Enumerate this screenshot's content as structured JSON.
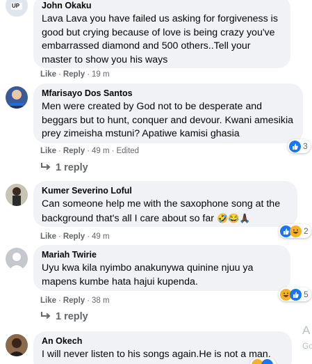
{
  "comments": [
    {
      "author": "John Okaku",
      "text": "Lava Lava you have failed us asking for forgiveness is good but crying because of love is being crazy you've embarrassed diamond and 500 others..Tell your master to show you his ways",
      "like_label": "Like",
      "reply_label": "Reply",
      "time": "19 m",
      "avatar_badge": "UP"
    },
    {
      "author": "Mfarisayo Dos Santos",
      "text": "Men were created by God not to be desperate and beggars but to hunt, conquer and devour. Kwani amesikia prey zimeisha mstuni? Apatiwe kamisi ghasia",
      "like_label": "Like",
      "reply_label": "Reply",
      "time": "49 m",
      "edited": "Edited",
      "reactions_count": "3",
      "replies_label": "1 reply"
    },
    {
      "author": "Kumer Severino Loful",
      "text": "Can someone help me with the saxophone song at the background that's all I care about so far",
      "emojis": "🤣😂🙏🏿",
      "like_label": "Like",
      "reply_label": "Reply",
      "time": "49 m",
      "reactions_count": "2"
    },
    {
      "author": "Mariah Twirie",
      "text": "Uyu kwa kila nyimbo anakunywa quinine njuu ya mapens kumbe hata hajui kupenda.",
      "like_label": "Like",
      "reply_label": "Reply",
      "time": "38 m",
      "reactions_count": "5",
      "replies_label": "1 reply"
    },
    {
      "author": "An Okech",
      "text": "I will never listen to his songs again.He is not a man."
    }
  ],
  "side_text": {
    "letter_a": "A",
    "letter_g": "Gc"
  },
  "colors": {
    "bubble": "#f0f2f5",
    "meta": "#65676b",
    "like_blue": "#1877f2",
    "haha_yellow": "#f7b125"
  }
}
